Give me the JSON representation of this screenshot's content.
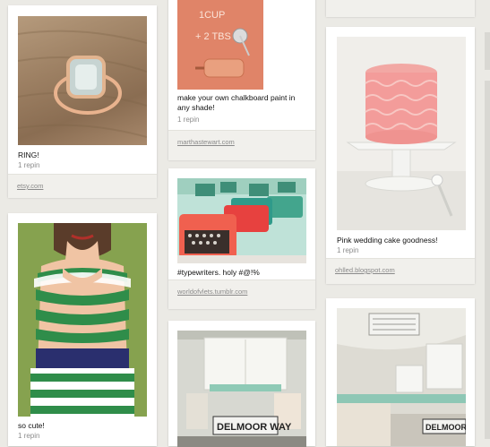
{
  "pins": [
    {
      "id": "ring",
      "description": "RING!",
      "repins": "1 repin",
      "source": "etsy.com",
      "image": "ring-photo"
    },
    {
      "id": "dress",
      "description": "so cute!",
      "repins": "1 repin",
      "source": "",
      "image": "striped-dress-photo"
    },
    {
      "id": "chalkboard",
      "description": "make your own chalkboard paint in any shade!",
      "repins": "1 repin",
      "source": "marthastewart.com",
      "image": "chalkboard-recipe-photo"
    },
    {
      "id": "typewriters",
      "description": "#typewriters. holy #@!%",
      "repins": "",
      "source": "worldofvlets.tumblr.com",
      "image": "typewriters-photo"
    },
    {
      "id": "cake",
      "description": "Pink wedding cake goodness!",
      "repins": "1 repin",
      "source": "ohlled.blogspot.com",
      "image": "pink-cake-photo"
    },
    {
      "id": "kitchen1",
      "description": "",
      "repins": "",
      "source": "",
      "image": "delmoor-way-kitchen-photo"
    },
    {
      "id": "kitchen2",
      "description": "",
      "repins": "",
      "source": "",
      "image": "trailer-kitchen-photo"
    }
  ],
  "photo_text": {
    "chalkboard_line1": "1CUP",
    "chalkboard_line2": "+ 2 TBS",
    "sign1": "DELMOOR WAY",
    "sign2": "DELMOOR"
  }
}
